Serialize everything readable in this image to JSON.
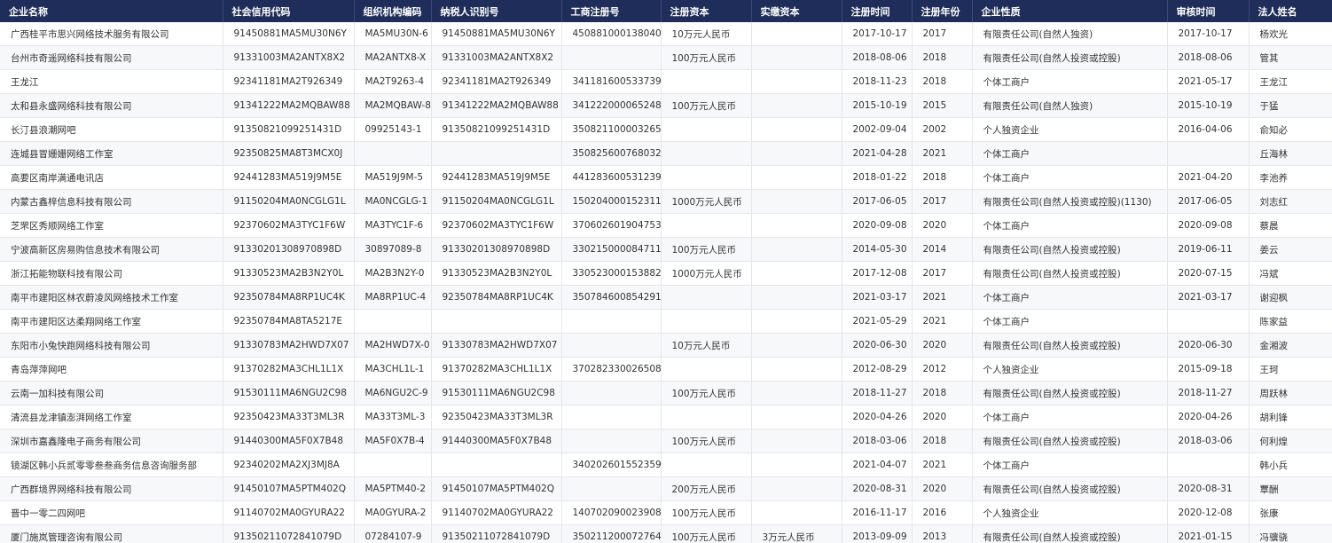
{
  "headers": [
    "企业名称",
    "社会信用代码",
    "组织机构编码",
    "纳税人识别号",
    "工商注册号",
    "注册资本",
    "实缴资本",
    "注册时间",
    "注册年份",
    "企业性质",
    "审核时间",
    "法人姓名"
  ],
  "rows": [
    [
      "广西桂平市思兴网络技术服务有限公司",
      "91450881MA5MU30N6Y",
      "MA5MU30N-6",
      "91450881MA5MU30N6Y",
      "450881000138040",
      "10万元人民币",
      "",
      "2017-10-17",
      "2017",
      "有限责任公司(自然人独资)",
      "2017-10-17",
      "杨欢光"
    ],
    [
      "台州市奇遥网络科技有限公司",
      "91331003MA2ANTX8X2",
      "MA2ANTX8-X",
      "91331003MA2ANTX8X2",
      "",
      "100万元人民币",
      "",
      "2018-08-06",
      "2018",
      "有限责任公司(自然人投资或控股)",
      "2018-08-06",
      "管其"
    ],
    [
      "王龙江",
      "92341181MA2T926349",
      "MA2T9263-4",
      "92341181MA2T926349",
      "341181600533739",
      "",
      "",
      "2018-11-23",
      "2018",
      "个体工商户",
      "2021-05-17",
      "王龙江"
    ],
    [
      "太和县永盛网络科技有限公司",
      "91341222MA2MQBAW88",
      "MA2MQBAW-8",
      "91341222MA2MQBAW88",
      "341222000065248",
      "100万元人民币",
      "",
      "2015-10-19",
      "2015",
      "有限责任公司(自然人独资)",
      "2015-10-19",
      "于猛"
    ],
    [
      "长汀县浪潮网吧",
      "91350821099251431D",
      "09925143-1",
      "91350821099251431D",
      "350821100003265",
      "",
      "",
      "2002-09-04",
      "2002",
      "个人独资企业",
      "2016-04-06",
      "俞知必"
    ],
    [
      "连城县冒姗姗网络工作室",
      "92350825MA8T3MCX0J",
      "",
      "",
      "350825600768032",
      "",
      "",
      "2021-04-28",
      "2021",
      "个体工商户",
      "",
      "丘海林"
    ],
    [
      "高要区南岸满通电讯店",
      "92441283MA519J9M5E",
      "MA519J9M-5",
      "92441283MA519J9M5E",
      "441283600531239",
      "",
      "",
      "2018-01-22",
      "2018",
      "个体工商户",
      "2021-04-20",
      "李池养"
    ],
    [
      "内蒙古鑫梓信息科技有限公司",
      "91150204MA0NCGLG1L",
      "MA0NCGLG-1",
      "91150204MA0NCGLG1L",
      "150204000152311",
      "1000万元人民币",
      "",
      "2017-06-05",
      "2017",
      "有限责任公司(自然人投资或控股)(1130)",
      "2017-06-05",
      "刘志红"
    ],
    [
      "芝罘区秀顺网络工作室",
      "92370602MA3TYC1F6W",
      "MA3TYC1F-6",
      "92370602MA3TYC1F6W",
      "370602601904753",
      "",
      "",
      "2020-09-08",
      "2020",
      "个体工商户",
      "2020-09-08",
      "蔡晨"
    ],
    [
      "宁波高新区房易购信息技术有限公司",
      "91330201308970898D",
      "30897089-8",
      "91330201308970898D",
      "330215000084711",
      "100万元人民币",
      "",
      "2014-05-30",
      "2014",
      "有限责任公司(自然人投资或控股)",
      "2019-06-11",
      "姜云"
    ],
    [
      "浙江拓能物联科技有限公司",
      "91330523MA2B3N2Y0L",
      "MA2B3N2Y-0",
      "91330523MA2B3N2Y0L",
      "330523000153882",
      "1000万元人民币",
      "",
      "2017-12-08",
      "2017",
      "有限责任公司(自然人投资或控股)",
      "2020-07-15",
      "冯斌"
    ],
    [
      "南平市建阳区林农蔚凌风网络技术工作室",
      "92350784MA8RP1UC4K",
      "MA8RP1UC-4",
      "92350784MA8RP1UC4K",
      "350784600854291",
      "",
      "",
      "2021-03-17",
      "2021",
      "个体工商户",
      "2021-03-17",
      "谢迎枫"
    ],
    [
      "南平市建阳区达柔翔网络工作室",
      "92350784MA8TA5217E",
      "",
      "",
      "",
      "",
      "",
      "2021-05-29",
      "2021",
      "个体工商户",
      "",
      "陈家益"
    ],
    [
      "东阳市小兔快跑网络科技有限公司",
      "91330783MA2HWD7X07",
      "MA2HWD7X-0",
      "91330783MA2HWD7X07",
      "",
      "10万元人民币",
      "",
      "2020-06-30",
      "2020",
      "有限责任公司(自然人投资或控股)",
      "2020-06-30",
      "金湘波"
    ],
    [
      "青岛萍萍网吧",
      "91370282MA3CHL1L1X",
      "MA3CHL1L-1",
      "91370282MA3CHL1L1X",
      "370282330026508",
      "",
      "",
      "2012-08-29",
      "2012",
      "个人独资企业",
      "2015-09-18",
      "王珂"
    ],
    [
      "云南一加科技有限公司",
      "91530111MA6NGU2C98",
      "MA6NGU2C-9",
      "91530111MA6NGU2C98",
      "",
      "100万元人民币",
      "",
      "2018-11-27",
      "2018",
      "有限责任公司(自然人投资或控股)",
      "2018-11-27",
      "周跃林"
    ],
    [
      "清流县龙津镇澎湃网络工作室",
      "92350423MA33T3ML3R",
      "MA33T3ML-3",
      "92350423MA33T3ML3R",
      "",
      "",
      "",
      "2020-04-26",
      "2020",
      "个体工商户",
      "2020-04-26",
      "胡利锋"
    ],
    [
      "深圳市嘉鑫隆电子商务有限公司",
      "91440300MA5F0X7B48",
      "MA5F0X7B-4",
      "91440300MA5F0X7B48",
      "",
      "100万元人民币",
      "",
      "2018-03-06",
      "2018",
      "有限责任公司(自然人投资或控股)",
      "2018-03-06",
      "何利煌"
    ],
    [
      "镜湖区韩小兵贰零零叁叁商务信息咨询服务部",
      "92340202MA2XJ3MJ8A",
      "",
      "",
      "340202601552359",
      "",
      "",
      "2021-04-07",
      "2021",
      "个体工商户",
      "",
      "韩小兵"
    ],
    [
      "广西群境界网络科技有限公司",
      "91450107MA5PTM402Q",
      "MA5PTM40-2",
      "91450107MA5PTM402Q",
      "",
      "200万元人民币",
      "",
      "2020-08-31",
      "2020",
      "有限责任公司(自然人投资或控股)",
      "2020-08-31",
      "覃酬"
    ],
    [
      "晋中一零二四网吧",
      "91140702MA0GYURA22",
      "MA0GYURA-2",
      "91140702MA0GYURA22",
      "140702090023908",
      "100万元人民币",
      "",
      "2016-11-17",
      "2016",
      "个人独资企业",
      "2020-12-08",
      "张康"
    ],
    [
      "厦门施岚管理咨询有限公司",
      "91350211072841079D",
      "07284107-9",
      "91350211072841079D",
      "350211200072764",
      "100万元人民币",
      "3万元人民币",
      "2013-09-09",
      "2013",
      "有限责任公司(自然人投资或控股)",
      "2021-01-15",
      "冯骥骁"
    ]
  ]
}
